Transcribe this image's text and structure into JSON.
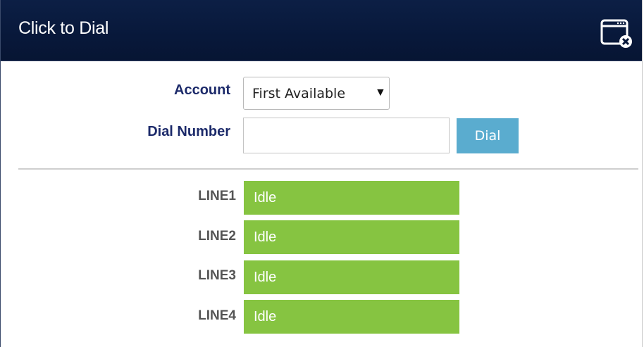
{
  "window": {
    "title": "Click to Dial"
  },
  "form": {
    "account_label": "Account",
    "account_selected": "First Available",
    "dial_number_label": "Dial Number",
    "dial_number_value": "",
    "dial_button": "Dial"
  },
  "lines": [
    {
      "label": "LINE1",
      "status": "Idle"
    },
    {
      "label": "LINE2",
      "status": "Idle"
    },
    {
      "label": "LINE3",
      "status": "Idle"
    },
    {
      "label": "LINE4",
      "status": "Idle"
    }
  ],
  "colors": {
    "titlebar": "#08183a",
    "label_text": "#1c2a6a",
    "dial_button": "#5aaccf",
    "line_idle": "#86c441"
  },
  "icons": {
    "close": "close-window-icon",
    "dropdown": "dropdown-caret-icon"
  }
}
